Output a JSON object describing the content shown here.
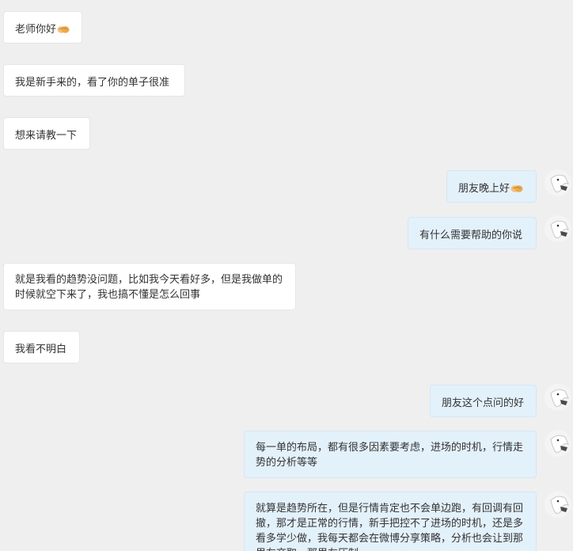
{
  "messages": [
    {
      "side": "left",
      "text": "老师你好",
      "emoji": "handshake"
    },
    {
      "side": "left",
      "text": "我是新手来的，看了你的单子很准"
    },
    {
      "side": "left",
      "text": "想来请教一下"
    },
    {
      "side": "right",
      "text": "朋友晚上好",
      "emoji": "handshake"
    },
    {
      "side": "right",
      "text": "有什么需要帮助的你说"
    },
    {
      "side": "left",
      "text": "就是我看的趋势没问题，比如我今天看好多，但是我做单的时候就空下来了，我也搞不懂是怎么回事"
    },
    {
      "side": "left",
      "text": "我看不明白"
    },
    {
      "side": "right",
      "text": "朋友这个点问的好"
    },
    {
      "side": "right",
      "text": "每一单的布局，都有很多因素要考虑，进场的时机，行情走势的分析等等"
    },
    {
      "side": "right",
      "text": "就算是趋势所在，但是行情肯定也不会单边跑，有回调有回撤，那才是正常的行情，新手把控不了进场的时机，还是多看多学少做，我每天都会在微博分享策略，分析也会让到那里左交取，那里左压制"
    }
  ],
  "colors": {
    "background": "#efefef",
    "left_bubble": "#ffffff",
    "right_bubble": "#e3f1fb"
  },
  "icons": {
    "emoji": "handshake-icon",
    "avatar": "avatar-icon"
  }
}
